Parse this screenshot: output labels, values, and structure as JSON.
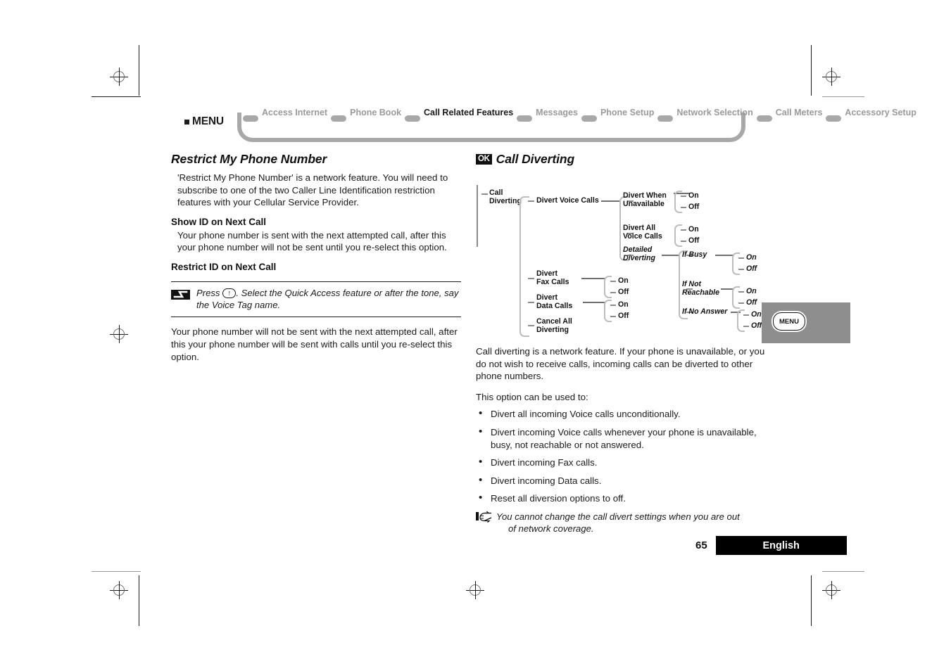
{
  "nav": {
    "menu_label": "MENU",
    "items": [
      {
        "label": "Access\nInternet",
        "active": false
      },
      {
        "label": "Phone\nBook",
        "active": false
      },
      {
        "label": "Call Related\nFeatures",
        "active": true
      },
      {
        "label": "Messages",
        "active": false
      },
      {
        "label": "Phone\nSetup",
        "active": false
      },
      {
        "label": "Network\nSelection",
        "active": false
      },
      {
        "label": "Call\nMeters",
        "active": false
      },
      {
        "label": "Accessory\nSetup",
        "active": false
      }
    ]
  },
  "left_column": {
    "title": "Restrict My Phone Number",
    "intro": "'Restrict My Phone Number' is a network feature. You will need to subscribe to one of the two Caller Line Identification restriction features with your Cellular Service Provider.",
    "sub1_title": "Show ID on Next Call",
    "sub1_body": "Your phone number is sent with the next attempted call, after this your phone number will not be sent until you re-select this option.",
    "sub2_title": "Restrict ID on Next Call",
    "note": {
      "icon": "lightning-bolt-icon",
      "text_before_key": "Press ",
      "keycap": "↑",
      "text_after_key": ". Select the Quick Access feature or after the tone, say the Voice Tag name."
    },
    "closing_body": "Your phone number will not be sent with the next attempted call, after this your phone number will be sent with calls until you re-select this option."
  },
  "right_column": {
    "badge": "OK",
    "title": "Call Diverting",
    "tree": {
      "root": "Call\nDiverting",
      "level1": [
        "Divert Voice Calls",
        "Divert\nFax Calls",
        "Divert\nData Calls",
        "Cancel All\nDiverting"
      ],
      "voice_children": [
        "Divert When\nUnavailable",
        "Divert All\nVoice Calls",
        "Detailed\nDiverting"
      ],
      "detailed_children": [
        "If Busy",
        "If Not\nReachable",
        "If No Answer"
      ],
      "on": "On",
      "off": "Off"
    },
    "intro": "Call diverting is a network feature. If your phone is unavailable, or you do not wish to receive calls, incoming calls can be diverted to other phone numbers.",
    "lead_in": "This option can be used to:",
    "bullets": [
      "Divert all incoming Voice calls unconditionally.",
      "Divert incoming Voice calls whenever your phone is unavailable, busy, not reachable or not answered.",
      "Divert incoming Fax calls.",
      "Divert incoming Data calls.",
      "Reset all diversion options to off."
    ],
    "hand_note": {
      "icon": "pointing-hand-icon",
      "line1": "You cannot change the call divert settings when you are out",
      "line2": "of network coverage."
    }
  },
  "menu_tab": {
    "label": "MENU"
  },
  "footer": {
    "page_number": "65",
    "language": "English"
  }
}
